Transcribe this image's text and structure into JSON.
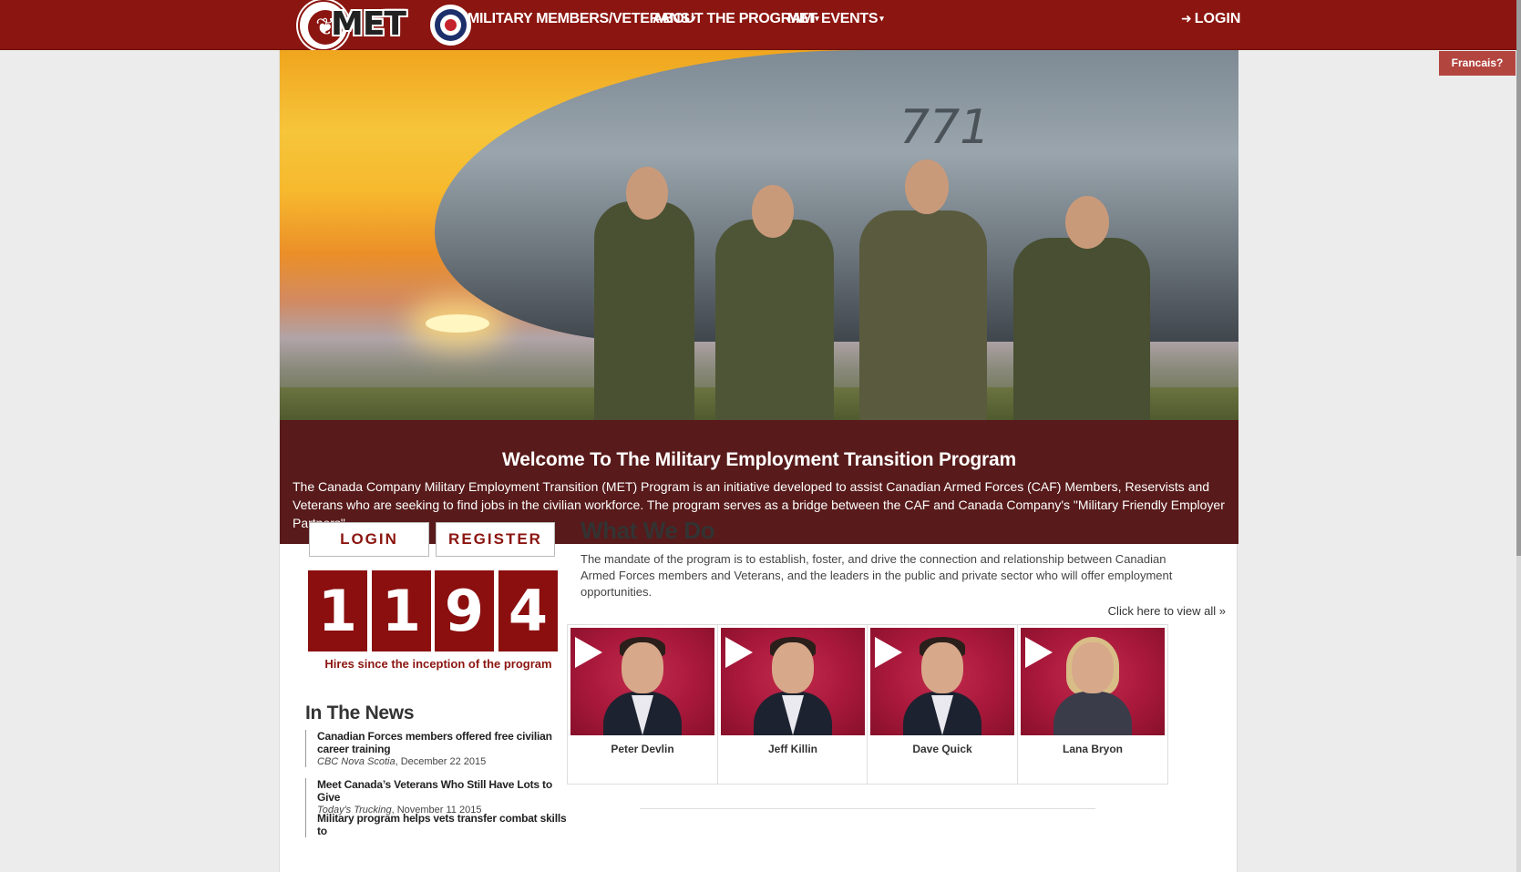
{
  "nav": {
    "logo_text": "MET",
    "items": [
      {
        "label": "MILITARY MEMBERS/VETERANS"
      },
      {
        "label": "ABOUT THE PROGRAM"
      },
      {
        "label": "MET EVENTS"
      }
    ],
    "login_label": "LOGIN"
  },
  "language_toggle": "Francais?",
  "hero": {
    "aircraft_number": "771"
  },
  "welcome": {
    "title": "Welcome To The Military Employment Transition Program",
    "body": "The Canada Company Military Employment Transition (MET) Program is an initiative developed to assist Canadian Armed Forces (CAF) Members, Reservists and Veterans who are seeking to find jobs in the civilian workforce. The program serves as a bridge between the CAF and Canada Company's \"Military Friendly Employer Partners\"."
  },
  "actions": {
    "login_label": "LOGIN",
    "register_label": "REGISTER"
  },
  "counter": {
    "digits": [
      "1",
      "1",
      "9",
      "4"
    ],
    "caption": "Hires since the inception of the program"
  },
  "news": {
    "title": "In The News",
    "items": [
      {
        "headline": "Canadian Forces members offered free civilian career training",
        "source": "CBC Nova Scotia",
        "date": ", December 22 2015"
      },
      {
        "headline": "Meet Canada’s Veterans Who Still Have Lots to Give",
        "source": "Today's Trucking",
        "date": ", November 11 2015"
      },
      {
        "headline": "Military program helps vets transfer combat skills to"
      }
    ]
  },
  "what_we_do": {
    "title": "What We Do",
    "body": "The mandate of the program is to establish, foster, and drive the connection and relationship between Canadian Armed Forces members and Veterans, and the leaders in the public and private sector who will offer employment opportunities.",
    "view_all": "Click here to view all »"
  },
  "videos": [
    {
      "name": "Peter Devlin"
    },
    {
      "name": "Jeff Killin"
    },
    {
      "name": "Dave Quick"
    },
    {
      "name": "Lana Bryon"
    }
  ],
  "colors": {
    "brand": "#8b1510",
    "welcome_bg": "#581a1a",
    "counter_bg": "#8b0f0f"
  }
}
